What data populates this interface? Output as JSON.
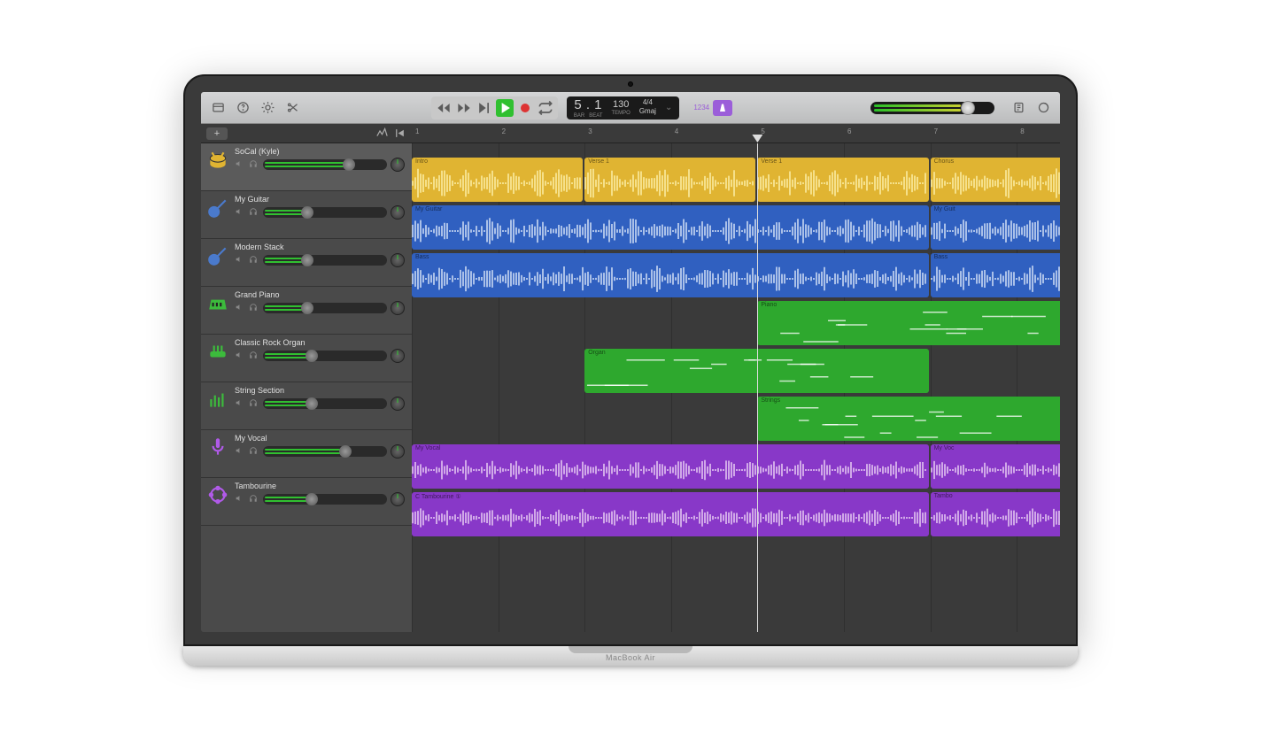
{
  "device_label": "MacBook Air",
  "lcd": {
    "bar_label": "BAR",
    "beat_label": "BEAT",
    "position": "5 . 1",
    "tempo": "130",
    "tempo_label": "TEMPO",
    "time_sig": "4/4",
    "key": "Gmaj"
  },
  "countin": "1234",
  "ruler": [
    "1",
    "2",
    "3",
    "4",
    "5",
    "6",
    "7",
    "8"
  ],
  "markers": [
    {
      "label": "Intro",
      "start": 0,
      "end": 2
    },
    {
      "label": "Verse 1",
      "start": 2,
      "end": 6
    },
    {
      "label": "Chorus",
      "start": 6,
      "end": 8
    }
  ],
  "playhead_bar": 4,
  "tracks": [
    {
      "name": "SoCal (Kyle)",
      "color": "yellow",
      "icon": "drums",
      "vol": 0.95,
      "selected": true
    },
    {
      "name": "My Guitar",
      "color": "blue",
      "icon": "guitar",
      "vol": 0.45
    },
    {
      "name": "Modern Stack",
      "color": "blue",
      "icon": "guitar",
      "vol": 0.45
    },
    {
      "name": "Grand Piano",
      "color": "green",
      "icon": "piano",
      "vol": 0.45
    },
    {
      "name": "Classic Rock Organ",
      "color": "green",
      "icon": "organ",
      "vol": 0.5
    },
    {
      "name": "String Section",
      "color": "green",
      "icon": "strings",
      "vol": 0.5
    },
    {
      "name": "My Vocal",
      "color": "purple",
      "icon": "mic",
      "vol": 0.9
    },
    {
      "name": "Tambourine",
      "color": "purple",
      "icon": "tamb",
      "vol": 0.5
    }
  ],
  "regions": [
    {
      "track": 0,
      "label": "",
      "start": 0,
      "end": 2,
      "color": "yellow",
      "type": "wave"
    },
    {
      "track": 0,
      "label": "",
      "start": 2,
      "end": 4,
      "color": "yellow",
      "type": "wave"
    },
    {
      "track": 0,
      "label": "",
      "start": 4,
      "end": 6,
      "color": "yellow",
      "type": "wave"
    },
    {
      "track": 0,
      "label": "",
      "start": 6,
      "end": 8,
      "color": "yellow",
      "type": "wave"
    },
    {
      "track": 1,
      "label": "My Guitar",
      "start": 0,
      "end": 6,
      "color": "blue",
      "type": "wave"
    },
    {
      "track": 1,
      "label": "My Guit",
      "start": 6,
      "end": 8,
      "color": "blue",
      "type": "wave"
    },
    {
      "track": 2,
      "label": "Bass",
      "start": 0,
      "end": 6,
      "color": "blue",
      "type": "wave"
    },
    {
      "track": 2,
      "label": "Bass",
      "start": 6,
      "end": 8,
      "color": "blue",
      "type": "wave"
    },
    {
      "track": 3,
      "label": "Piano",
      "start": 4,
      "end": 8,
      "color": "green",
      "type": "midi"
    },
    {
      "track": 4,
      "label": "Organ",
      "start": 2,
      "end": 6,
      "color": "green",
      "type": "midi"
    },
    {
      "track": 5,
      "label": "Strings",
      "start": 4,
      "end": 8,
      "color": "green",
      "type": "midi"
    },
    {
      "track": 6,
      "label": "My Vocal",
      "start": 0,
      "end": 6,
      "color": "purple",
      "type": "wave"
    },
    {
      "track": 6,
      "label": "My Voc",
      "start": 6,
      "end": 8,
      "color": "purple",
      "type": "wave"
    },
    {
      "track": 7,
      "label": "C Tambourine ①",
      "start": 0,
      "end": 6,
      "color": "purple",
      "type": "wave"
    },
    {
      "track": 7,
      "label": "Tambo",
      "start": 6,
      "end": 8,
      "color": "purple",
      "type": "wave"
    }
  ]
}
